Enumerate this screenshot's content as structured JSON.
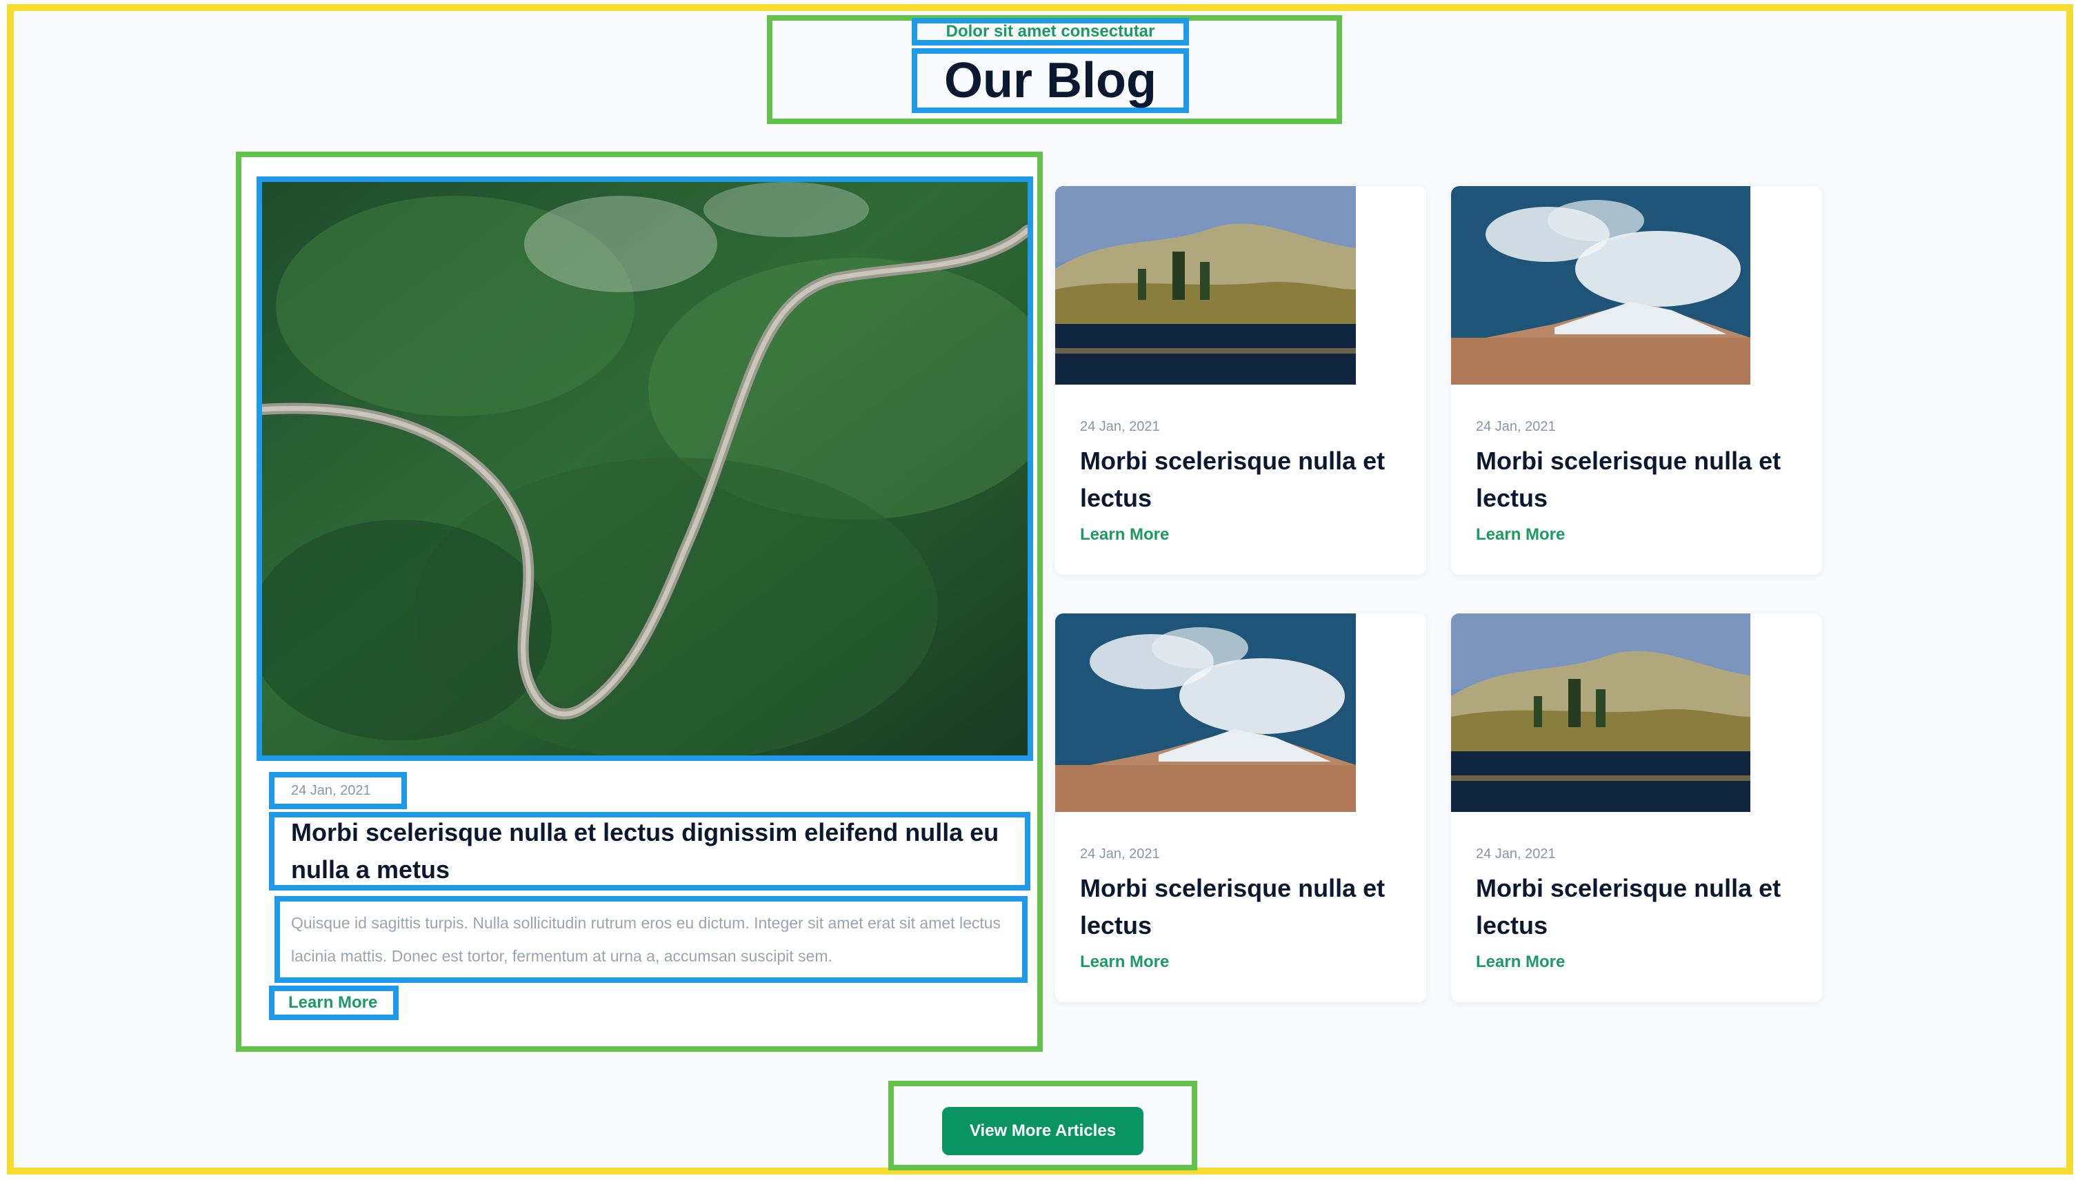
{
  "header": {
    "eyebrow": "Dolor sit amet consectutar",
    "title": "Our Blog"
  },
  "featured": {
    "image_icon": "landscape-image-icon",
    "date": "24 Jan, 2021",
    "title": "Morbi scelerisque nulla et lectus dignissim eleifend nulla eu nulla a metus",
    "excerpt": "Quisque id sagittis turpis. Nulla sollicitudin rutrum eros eu dictum. Integer sit amet erat sit amet lectus lacinia mattis. Donec est tortor, fermentum at urna a, accumsan suscipit sem.",
    "learn_more": "Learn More"
  },
  "posts": [
    {
      "date": "24 Jan, 2021",
      "title": "Morbi scelerisque nulla et lectus",
      "learn_more": "Learn More"
    },
    {
      "date": "24 Jan, 2021",
      "title": "Morbi scelerisque nulla et lectus",
      "learn_more": "Learn More"
    },
    {
      "date": "24 Jan, 2021",
      "title": "Morbi scelerisque nulla et lectus",
      "learn_more": "Learn More"
    },
    {
      "date": "24 Jan, 2021",
      "title": "Morbi scelerisque nulla et lectus",
      "learn_more": "Learn More"
    }
  ],
  "cta": {
    "label": "View More Articles"
  },
  "colors": {
    "accent": "#0a9462",
    "heading": "#0b1930",
    "muted": "#8a94a6",
    "annotation_green": "#63c24b",
    "annotation_blue": "#1e9ae8",
    "annotation_yellow": "#f5dc2f"
  }
}
